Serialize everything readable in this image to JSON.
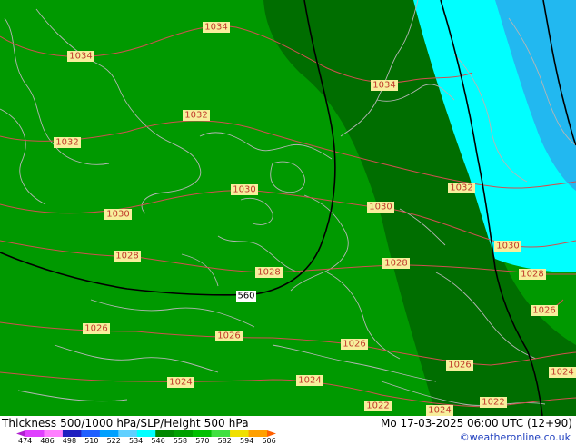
{
  "footer": {
    "title": "Thickness 500/1000 hPa/SLP/Height 500 hPa",
    "datetime": "Mo 17-03-2025 06:00 UTC (12+90)",
    "credit": "©weatheronline.co.uk"
  },
  "legend": {
    "colors": [
      "#b020d0",
      "#e040ff",
      "#ff80ff",
      "#2020c0",
      "#2060ff",
      "#00a0ff",
      "#60d0ff",
      "#00ffff",
      "#008800",
      "#00a000",
      "#00c000",
      "#40e040",
      "#f0e000",
      "#ffa000",
      "#ff6000"
    ],
    "ticks": [
      "474",
      "486",
      "498",
      "510",
      "522",
      "534",
      "546",
      "558",
      "570",
      "582",
      "594",
      "606"
    ]
  },
  "map": {
    "colors": {
      "green_light": "#009900",
      "green_dark": "#006e00",
      "cyan": "#00ffff",
      "blue": "#22b8f0",
      "isobar": "#d05050",
      "coast": "#b5b5b5"
    },
    "isobar_labels": [
      "1034",
      "1034",
      "1034",
      "1032",
      "1032",
      "1032",
      "1030",
      "1030",
      "1030",
      "1030",
      "1028",
      "1028",
      "1028",
      "1028",
      "1026",
      "1026",
      "1026",
      "1026",
      "1026",
      "1024",
      "1024",
      "1024",
      "1024",
      "1022",
      "1022"
    ],
    "thickness_label": "560"
  }
}
